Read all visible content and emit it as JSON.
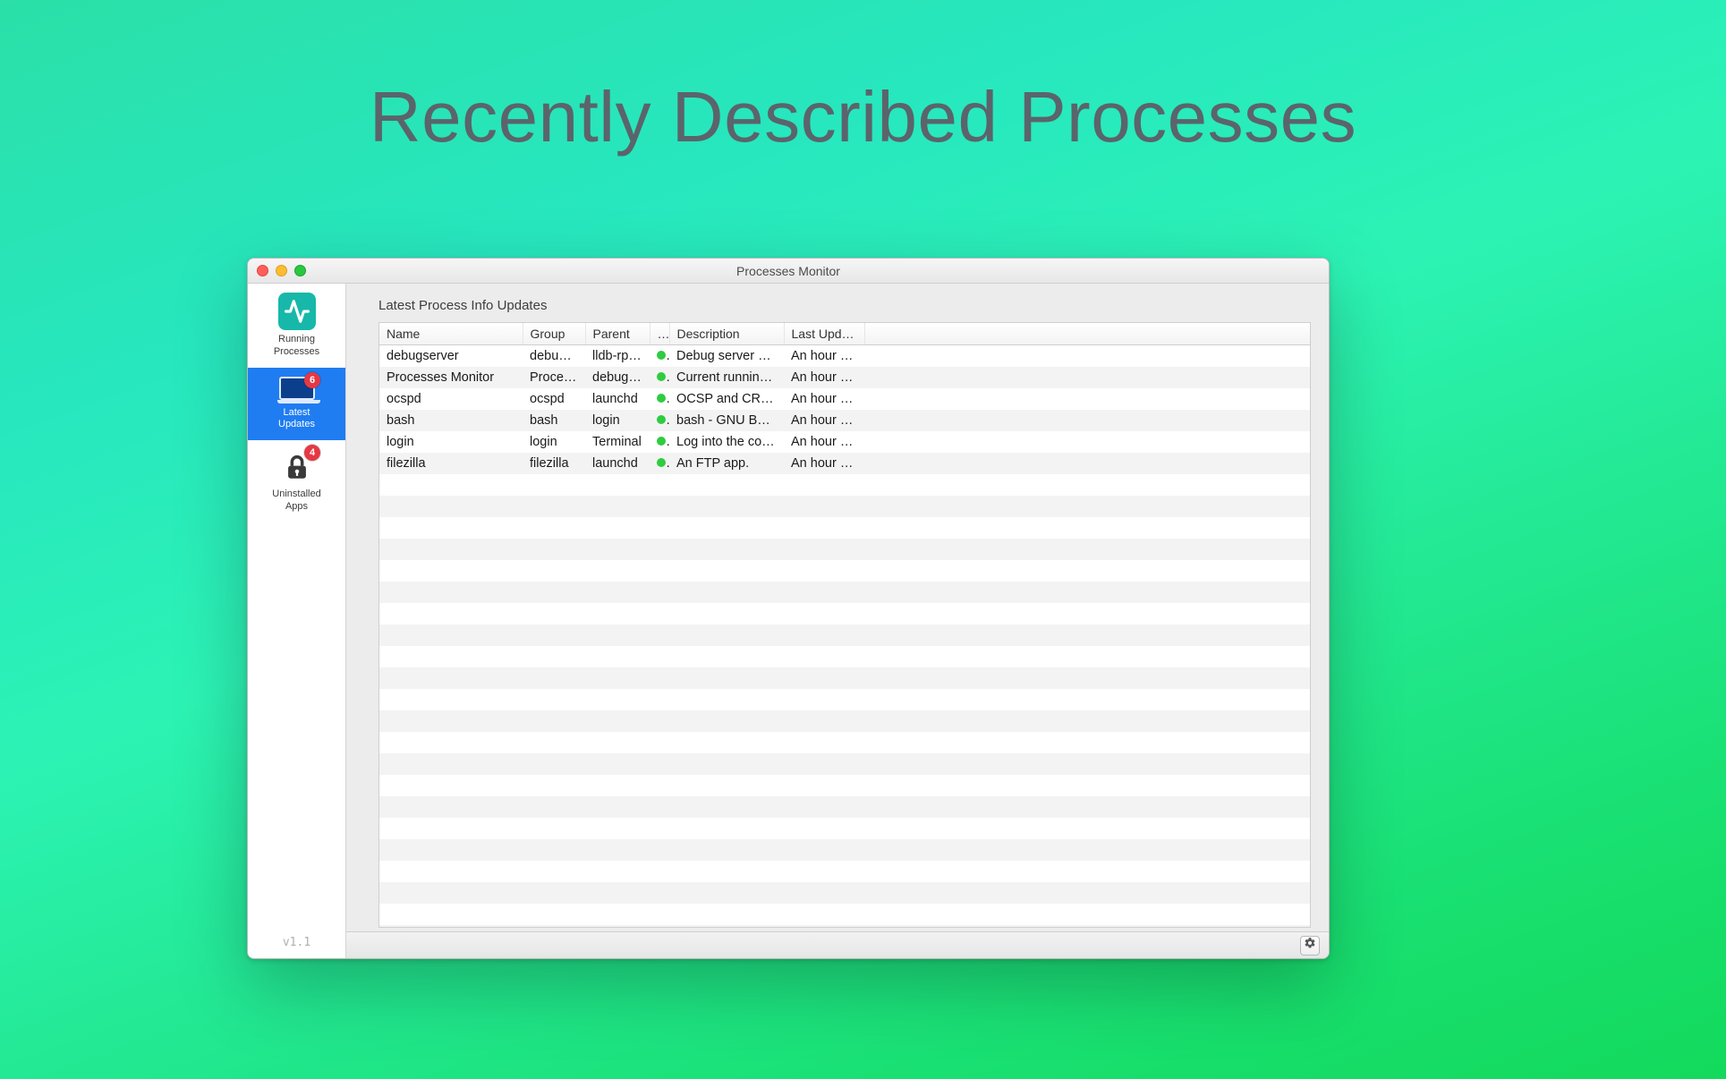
{
  "page_heading": "Recently Described Processes",
  "window_title": "Processes Monitor",
  "sidebar": {
    "items": [
      {
        "label": "Running\nProcesses",
        "badge": null
      },
      {
        "label": "Latest\nUpdates",
        "badge": "6"
      },
      {
        "label": "Uninstalled\nApps",
        "badge": "4"
      }
    ],
    "version": "v1.1"
  },
  "content": {
    "section_title": "Latest Process Info Updates",
    "columns": {
      "name": "Name",
      "group": "Group",
      "parent": "Parent",
      "indicator": "…",
      "description": "Description",
      "last_updated": "Last Updated"
    },
    "rows": [
      {
        "name": "debugserver",
        "group": "debugs…",
        "parent": "lldb-rpc…",
        "status": "green",
        "description": "Debug server ma…",
        "last_updated": "An hour ago"
      },
      {
        "name": "Processes Monitor",
        "group": "Process…",
        "parent": "debugs…",
        "status": "green",
        "description": "Current running…",
        "last_updated": "An hour ago"
      },
      {
        "name": "ocspd",
        "group": "ocspd",
        "parent": "launchd",
        "status": "green",
        "description": "OCSP and CRL D…",
        "last_updated": "An hour ago"
      },
      {
        "name": "bash",
        "group": "bash",
        "parent": "login",
        "status": "green",
        "description": "bash - GNU Bour…",
        "last_updated": "An hour ago"
      },
      {
        "name": "login",
        "group": "login",
        "parent": "Terminal",
        "status": "green",
        "description": "Log into the com…",
        "last_updated": "An hour ago"
      },
      {
        "name": "filezilla",
        "group": "filezilla",
        "parent": "launchd",
        "status": "green",
        "description": "An FTP app.",
        "last_updated": "An hour ago"
      }
    ]
  }
}
